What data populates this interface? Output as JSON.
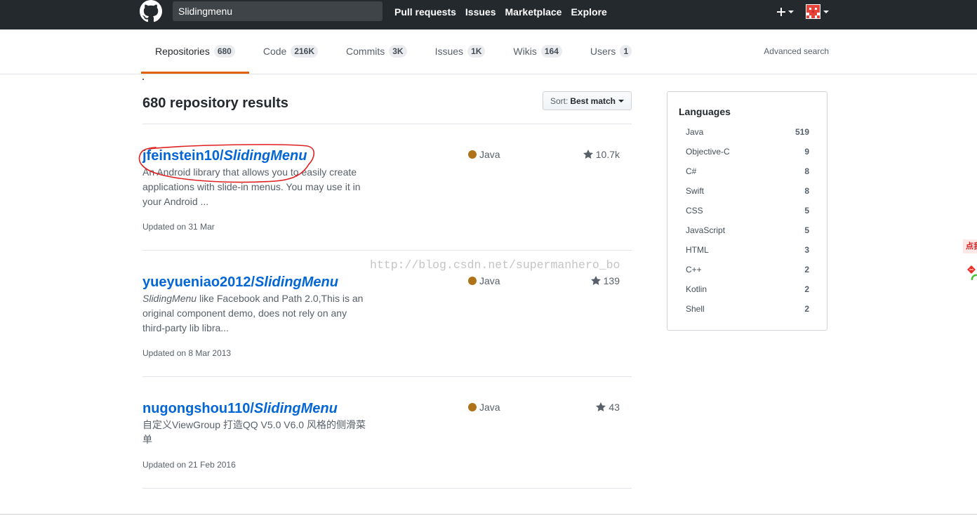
{
  "header": {
    "logo_icon": "github-mark-icon",
    "search_value": "Slidingmenu",
    "nav": [
      "Pull requests",
      "Issues",
      "Marketplace",
      "Explore"
    ],
    "create_icon": "plus-icon",
    "avatar_icon": "user-avatar"
  },
  "tabs": [
    {
      "label": "Repositories",
      "count": "680",
      "selected": true
    },
    {
      "label": "Code",
      "count": "216K",
      "selected": false
    },
    {
      "label": "Commits",
      "count": "3K",
      "selected": false
    },
    {
      "label": "Issues",
      "count": "1K",
      "selected": false
    },
    {
      "label": "Wikis",
      "count": "164",
      "selected": false
    },
    {
      "label": "Users",
      "count": "1",
      "selected": false
    }
  ],
  "advanced_search": "Advanced search",
  "results_heading": "680 repository results",
  "sort": {
    "prefix": "Sort:",
    "value": "Best match"
  },
  "results": [
    {
      "owner": "jfeinstein10/",
      "name": "SlidingMenu",
      "description_text": "An Android library that allows you to easily create applications with slide-in menus. You may use it in your Android ...",
      "language": "Java",
      "language_color": "#b07219",
      "stars": "10.7k",
      "updated": "Updated on 31 Mar"
    },
    {
      "owner": "yueyueniao2012/",
      "name": "SlidingMenu",
      "description_em": "SlidingMenu",
      "description_text": " like Facebook and Path 2.0,This is an original component demo, does not rely on any third-party lib libra...",
      "language": "Java",
      "language_color": "#b07219",
      "stars": "139",
      "updated": "Updated on 8 Mar 2013"
    },
    {
      "owner": "nugongshou110/",
      "name": "SlidingMenu",
      "description_text": "自定义ViewGroup 打造QQ V5.0 V6.0 风格的侧滑菜单",
      "language": "Java",
      "language_color": "#b07219",
      "stars": "43",
      "updated": "Updated on 21 Feb 2016"
    }
  ],
  "languages": {
    "title": "Languages",
    "items": [
      {
        "name": "Java",
        "count": "519"
      },
      {
        "name": "Objective-C",
        "count": "9"
      },
      {
        "name": "C#",
        "count": "8"
      },
      {
        "name": "Swift",
        "count": "8"
      },
      {
        "name": "CSS",
        "count": "5"
      },
      {
        "name": "JavaScript",
        "count": "5"
      },
      {
        "name": "HTML",
        "count": "3"
      },
      {
        "name": "C++",
        "count": "2"
      },
      {
        "name": "Kotlin",
        "count": "2"
      },
      {
        "name": "Shell",
        "count": "2"
      }
    ]
  },
  "watermark": "http://blog.csdn.net/supermanhero_bo",
  "side_widget": {
    "label": "点我"
  },
  "colors": {
    "header_bg": "#24292e",
    "link": "#0366d6",
    "selected_tab_accent": "#e36209",
    "annotation": "#e02020"
  }
}
